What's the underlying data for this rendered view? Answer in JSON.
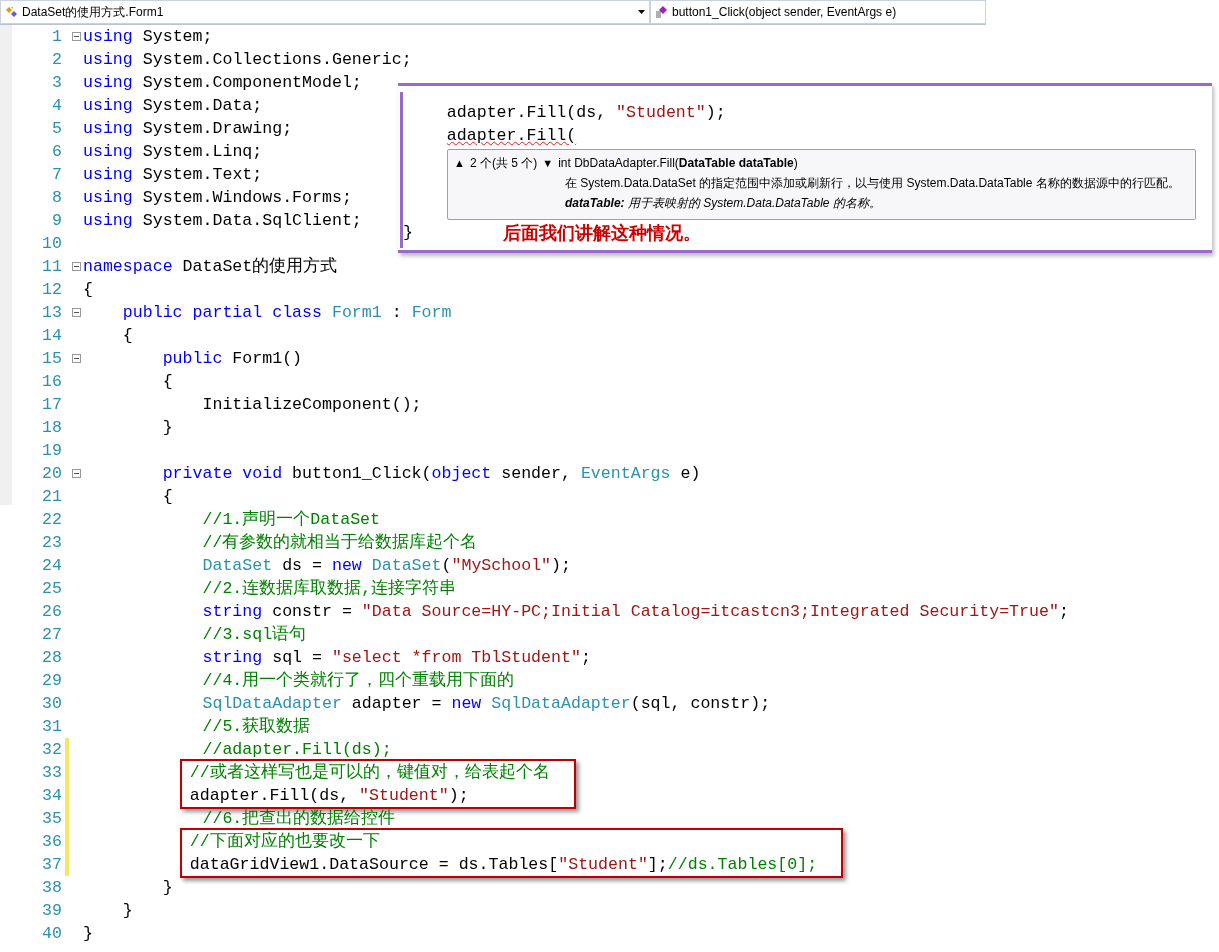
{
  "nav_bar": {
    "class_dropdown": {
      "label": "DataSet的使用方式.Form1"
    },
    "member_dropdown": {
      "label": "button1_Click(object sender, EventArgs e)"
    }
  },
  "editor": {
    "lines": [
      {
        "kind": "line",
        "number": "1",
        "foldable": true,
        "changed": false,
        "tokens": [
          {
            "kind": "kw",
            "text": "using"
          },
          {
            "kind": "plain",
            "text": " System;"
          }
        ]
      },
      {
        "kind": "line",
        "number": "2",
        "foldable": false,
        "changed": false,
        "tokens": [
          {
            "kind": "kw",
            "text": "using"
          },
          {
            "kind": "plain",
            "text": " System.Collections.Generic;"
          }
        ]
      },
      {
        "kind": "line",
        "number": "3",
        "foldable": false,
        "changed": false,
        "tokens": [
          {
            "kind": "kw",
            "text": "using"
          },
          {
            "kind": "plain",
            "text": " System.ComponentModel;"
          }
        ]
      },
      {
        "kind": "line",
        "number": "4",
        "foldable": false,
        "changed": false,
        "tokens": [
          {
            "kind": "kw",
            "text": "using"
          },
          {
            "kind": "plain",
            "text": " System.Data;"
          }
        ]
      },
      {
        "kind": "line",
        "number": "5",
        "foldable": false,
        "changed": false,
        "tokens": [
          {
            "kind": "kw",
            "text": "using"
          },
          {
            "kind": "plain",
            "text": " System.Drawing;"
          }
        ]
      },
      {
        "kind": "line",
        "number": "6",
        "foldable": false,
        "changed": false,
        "tokens": [
          {
            "kind": "kw",
            "text": "using"
          },
          {
            "kind": "plain",
            "text": " System.Linq;"
          }
        ]
      },
      {
        "kind": "line",
        "number": "7",
        "foldable": false,
        "changed": false,
        "tokens": [
          {
            "kind": "kw",
            "text": "using"
          },
          {
            "kind": "plain",
            "text": " System.Text;"
          }
        ]
      },
      {
        "kind": "line",
        "number": "8",
        "foldable": false,
        "changed": false,
        "tokens": [
          {
            "kind": "kw",
            "text": "using"
          },
          {
            "kind": "plain",
            "text": " System.Windows.Forms;"
          }
        ]
      },
      {
        "kind": "line",
        "number": "9",
        "foldable": false,
        "changed": false,
        "tokens": [
          {
            "kind": "kw",
            "text": "using"
          },
          {
            "kind": "plain",
            "text": " System.Data.SqlClient;"
          }
        ]
      },
      {
        "kind": "line",
        "number": "10",
        "foldable": false,
        "changed": false
      },
      {
        "kind": "line",
        "number": "11",
        "foldable": true,
        "changed": false,
        "tokens": [
          {
            "kind": "kw",
            "text": "namespace"
          },
          {
            "kind": "plain",
            "text": " DataSet的使用方式"
          }
        ]
      },
      {
        "kind": "line",
        "number": "12",
        "foldable": false,
        "changed": false,
        "tokens": [
          {
            "kind": "plain",
            "text": "{"
          }
        ]
      },
      {
        "kind": "line",
        "number": "13",
        "foldable": true,
        "changed": false,
        "tokens": [
          {
            "kind": "kw",
            "text": "    public partial class"
          },
          {
            "kind": "type",
            "text": " Form1"
          },
          {
            "kind": "plain",
            "text": " : "
          },
          {
            "kind": "type",
            "text": "Form"
          }
        ]
      },
      {
        "kind": "line",
        "number": "14",
        "foldable": false,
        "changed": false,
        "tokens": [
          {
            "kind": "plain",
            "text": "    {"
          }
        ]
      },
      {
        "kind": "line",
        "number": "15",
        "foldable": true,
        "changed": false,
        "tokens": [
          {
            "kind": "kw",
            "text": "        public"
          },
          {
            "kind": "plain",
            "text": " Form1()"
          }
        ]
      },
      {
        "kind": "line",
        "number": "16",
        "foldable": false,
        "changed": false,
        "tokens": [
          {
            "kind": "plain",
            "text": "        {"
          }
        ]
      },
      {
        "kind": "line",
        "number": "17",
        "foldable": false,
        "changed": false,
        "tokens": [
          {
            "kind": "plain",
            "text": "            InitializeComponent();"
          }
        ]
      },
      {
        "kind": "line",
        "number": "18",
        "foldable": false,
        "changed": false,
        "tokens": [
          {
            "kind": "plain",
            "text": "        }"
          }
        ]
      },
      {
        "kind": "line",
        "number": "19",
        "foldable": false,
        "changed": false
      },
      {
        "kind": "line",
        "number": "20",
        "foldable": true,
        "changed": false,
        "tokens": [
          {
            "kind": "kw",
            "text": "        private void"
          },
          {
            "kind": "plain",
            "text": " button1_Click("
          },
          {
            "kind": "kw",
            "text": "object"
          },
          {
            "kind": "plain",
            "text": " sender, "
          },
          {
            "kind": "type",
            "text": "EventArgs"
          },
          {
            "kind": "plain",
            "text": " e)"
          }
        ]
      },
      {
        "kind": "line",
        "number": "21",
        "foldable": false,
        "changed": false,
        "tokens": [
          {
            "kind": "plain",
            "text": "        {"
          }
        ]
      },
      {
        "kind": "line",
        "number": "22",
        "foldable": false,
        "changed": false,
        "tokens": [
          {
            "kind": "comment",
            "text": "            //1.声明一个DataSet"
          }
        ]
      },
      {
        "kind": "line",
        "number": "23",
        "foldable": false,
        "changed": false,
        "tokens": [
          {
            "kind": "comment",
            "text": "            //有参数的就相当于给数据库起个名"
          }
        ]
      },
      {
        "kind": "line",
        "number": "24",
        "foldable": false,
        "changed": false,
        "tokens": [
          {
            "kind": "type",
            "text": "            DataSet"
          },
          {
            "kind": "plain",
            "text": " ds = "
          },
          {
            "kind": "kw",
            "text": "new"
          },
          {
            "kind": "type",
            "text": " DataSet"
          },
          {
            "kind": "plain",
            "text": "("
          },
          {
            "kind": "str",
            "text": "\"MySchool\""
          },
          {
            "kind": "plain",
            "text": ");"
          }
        ]
      },
      {
        "kind": "line",
        "number": "25",
        "foldable": false,
        "changed": false,
        "tokens": [
          {
            "kind": "comment",
            "text": "            //2.连数据库取数据,连接字符串"
          }
        ]
      },
      {
        "kind": "line",
        "number": "26",
        "foldable": false,
        "changed": false,
        "tokens": [
          {
            "kind": "kw",
            "text": "            string"
          },
          {
            "kind": "plain",
            "text": " constr = "
          },
          {
            "kind": "str",
            "text": "\"Data Source=HY-PC;Initial Catalog=itcastcn3;Integrated Security=True\""
          },
          {
            "kind": "plain",
            "text": ";"
          }
        ]
      },
      {
        "kind": "line",
        "number": "27",
        "foldable": false,
        "changed": false,
        "tokens": [
          {
            "kind": "comment",
            "text": "            //3.sql语句"
          }
        ]
      },
      {
        "kind": "line",
        "number": "28",
        "foldable": false,
        "changed": false,
        "tokens": [
          {
            "kind": "kw",
            "text": "            string"
          },
          {
            "kind": "plain",
            "text": " sql = "
          },
          {
            "kind": "str",
            "text": "\"select *from TblStudent\""
          },
          {
            "kind": "plain",
            "text": ";"
          }
        ]
      },
      {
        "kind": "line",
        "number": "29",
        "foldable": false,
        "changed": false,
        "tokens": [
          {
            "kind": "comment",
            "text": "            //4.用一个类就行了，四个重载用下面的"
          }
        ]
      },
      {
        "kind": "line",
        "number": "30",
        "foldable": false,
        "changed": false,
        "tokens": [
          {
            "kind": "type",
            "text": "            SqlDataAdapter"
          },
          {
            "kind": "plain",
            "text": " adapter = "
          },
          {
            "kind": "kw",
            "text": "new"
          },
          {
            "kind": "type",
            "text": " SqlDataAdapter"
          },
          {
            "kind": "plain",
            "text": "(sql, constr);"
          }
        ]
      },
      {
        "kind": "line",
        "number": "31",
        "foldable": false,
        "changed": false,
        "tokens": [
          {
            "kind": "comment",
            "text": "            //5.获取数据"
          }
        ]
      },
      {
        "kind": "line",
        "number": "32",
        "foldable": false,
        "changed": true,
        "tokens": [
          {
            "kind": "comment",
            "text": "            //adapter.Fill(ds);"
          }
        ]
      },
      {
        "kind": "box",
        "lines": [
          {
            "kind": "line",
            "number": "33",
            "foldable": false,
            "changed": true,
            "tokens": [
              {
                "kind": "comment",
                "text": "            //或者这样写也是可以的，键值对，给表起个名"
              }
            ]
          },
          {
            "kind": "line",
            "number": "34",
            "foldable": false,
            "changed": true,
            "tokens": [
              {
                "kind": "plain",
                "text": "            adapter.Fill(ds, "
              },
              {
                "kind": "str",
                "text": "\"Student\""
              },
              {
                "kind": "plain",
                "text": ");"
              }
            ]
          }
        ]
      },
      {
        "kind": "line",
        "number": "35",
        "foldable": false,
        "changed": true,
        "tokens": [
          {
            "kind": "comment",
            "text": "            //6.把查出的数据给控件"
          }
        ]
      },
      {
        "kind": "box",
        "lines": [
          {
            "kind": "line",
            "number": "36",
            "foldable": false,
            "changed": true,
            "tokens": [
              {
                "kind": "comment",
                "text": "            //下面对应的也要改一下"
              }
            ]
          },
          {
            "kind": "line",
            "number": "37",
            "foldable": false,
            "changed": true,
            "tokens": [
              {
                "kind": "plain",
                "text": "            dataGridView1.DataSource = ds.Tables["
              },
              {
                "kind": "str",
                "text": "\"Student\""
              },
              {
                "kind": "plain",
                "text": "];"
              },
              {
                "kind": "comment",
                "text": "//ds.Tables[0];"
              }
            ]
          }
        ]
      },
      {
        "kind": "line",
        "number": "38",
        "foldable": false,
        "changed": false,
        "tokens": [
          {
            "kind": "plain",
            "text": "        }"
          }
        ]
      },
      {
        "kind": "line",
        "number": "39",
        "foldable": false,
        "changed": false,
        "tokens": [
          {
            "kind": "plain",
            "text": "    }"
          }
        ]
      },
      {
        "kind": "line",
        "number": "40",
        "foldable": false,
        "changed": false,
        "tokens": [
          {
            "kind": "plain",
            "text": "}"
          }
        ]
      }
    ]
  },
  "inset": {
    "lines": [
      {
        "error": false,
        "tokens": [
          {
            "kind": "plain",
            "text": "    adapter.Fill(ds, "
          },
          {
            "kind": "str",
            "text": "\"Student\""
          },
          {
            "kind": "plain",
            "text": ");"
          }
        ]
      },
      {
        "error": true,
        "tokens": [
          {
            "kind": "plain",
            "text": "    adapter.Fill("
          }
        ]
      }
    ],
    "tooltip": {
      "prev": "▲",
      "counter": "2 个(共 5 个)",
      "next": "▼",
      "signature": "int DbDataAdapter.Fill(**DataTable dataTable**)",
      "description": "在 System.Data.DataSet 的指定范围中添加或刷新行，以与使用 System.Data.DataTable 名称的数据源中的行匹配。",
      "param": "**dataTable:** 用于表映射的 System.Data.DataTable 的名称。"
    },
    "closing": {
      "tokens": [
        {
          "kind": "plain",
          "text": "}"
        }
      ]
    },
    "note": "后面我们讲解这种情况。"
  }
}
